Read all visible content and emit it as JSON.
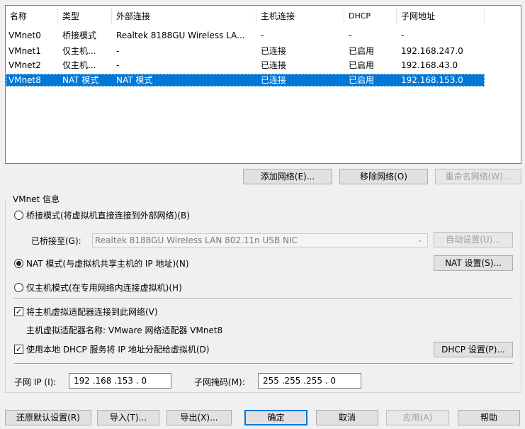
{
  "table": {
    "headers": [
      "名称",
      "类型",
      "外部连接",
      "主机连接",
      "DHCP",
      "子网地址"
    ],
    "rows": [
      {
        "name": "VMnet0",
        "type": "桥接模式",
        "external": "Realtek 8188GU Wireless LA...",
        "host": "-",
        "dhcp": "-",
        "subnet": "-"
      },
      {
        "name": "VMnet1",
        "type": "仅主机...",
        "external": "-",
        "host": "已连接",
        "dhcp": "已启用",
        "subnet": "192.168.247.0"
      },
      {
        "name": "VMnet2",
        "type": "仅主机...",
        "external": "-",
        "host": "已连接",
        "dhcp": "已启用",
        "subnet": "192.168.43.0"
      },
      {
        "name": "VMnet8",
        "type": "NAT 模式",
        "external": "NAT 模式",
        "host": "已连接",
        "dhcp": "已启用",
        "subnet": "192.168.153.0"
      }
    ]
  },
  "net_buttons": {
    "add": "添加网络(E)...",
    "remove": "移除网络(O)",
    "rename": "重命名网络(W)..."
  },
  "info": {
    "title": "VMnet 信息",
    "bridged_label": "桥接模式(将虚拟机直接连接到外部网络)(B)",
    "bridged_to_label": "已桥接至(G):",
    "bridged_to_value": "Realtek 8188GU Wireless LAN 802.11n USB NIC",
    "auto_settings": "自动设置(U)...",
    "nat_label": "NAT 模式(与虚拟机共享主机的 IP 地址)(N)",
    "nat_settings": "NAT 设置(S)...",
    "hostonly_label": "仅主机模式(在专用网络内连接虚拟机)(H)",
    "connect_adapter_label": "将主机虚拟适配器连接到此网络(V)",
    "adapter_name_text": "主机虚拟适配器名称: VMware 网络适配器 VMnet8",
    "dhcp_label": "使用本地 DHCP 服务将 IP 地址分配给虚拟机(D)",
    "dhcp_settings": "DHCP 设置(P)...",
    "subnet_ip_label": "子网 IP (I):",
    "subnet_ip_value": "192 .168 .153 . 0",
    "subnet_mask_label": "子网掩码(M):",
    "subnet_mask_value": "255 .255 .255 . 0"
  },
  "bottom": {
    "restore": "还原默认设置(R)",
    "import": "导入(T)...",
    "export": "导出(X)...",
    "ok": "确定",
    "cancel": "取消",
    "apply": "应用(A)",
    "help": "帮助"
  },
  "colors": {
    "selection": "#0078d7",
    "window_bg": "#f0f0f0"
  }
}
